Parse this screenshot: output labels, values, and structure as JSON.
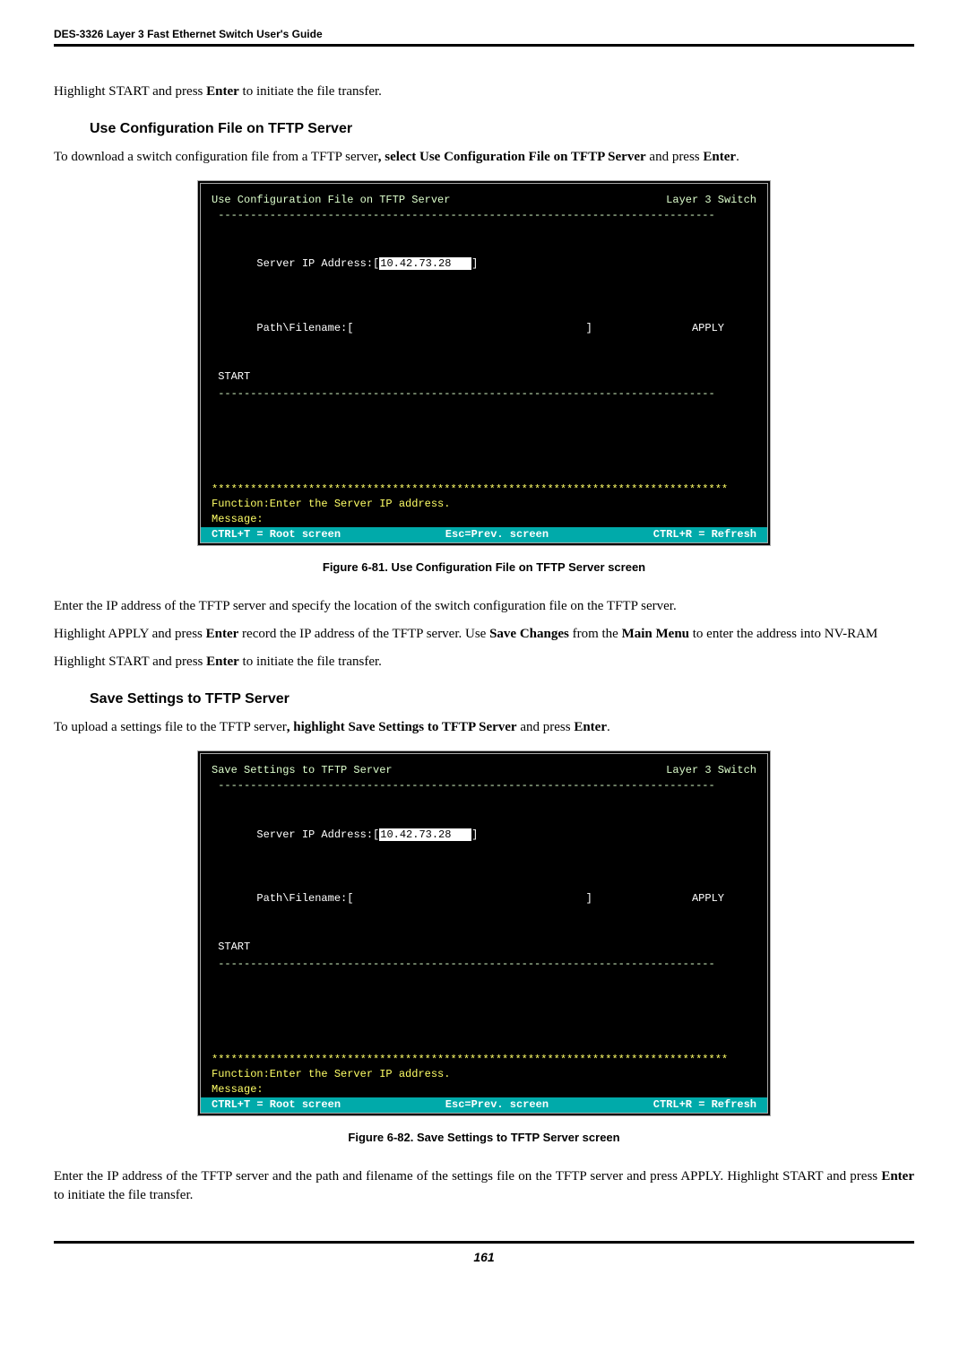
{
  "doc": {
    "headerLine": "DES-3326 Layer 3 Fast Ethernet Switch User's Guide",
    "p1_pre": "Highlight START and press ",
    "p1_b": "Enter",
    "p1_post": " to initiate the file transfer.",
    "sub1": "Use Configuration File on TFTP Server",
    "p2_pre": "To download a switch configuration file from a TFTP server",
    "p2_mid": ", select ",
    "p2_b1": "Use Configuration File on TFTP Server",
    "p2_mid2": " and press ",
    "p2_b2": "Enter",
    "p2_post": ".",
    "figcap1": "Figure 6-81.  Use Configuration File on TFTP Server screen",
    "p3": "Enter the IP address of the TFTP server and specify the location of the switch configuration file on the TFTP server.",
    "p4_pre": "Highlight APPLY and press ",
    "p4_b1": "Enter",
    "p4_mid": " record the IP address of the TFTP server. Use ",
    "p4_b2": "Save Changes",
    "p4_mid2": " from the ",
    "p4_b3": "Main Menu",
    "p4_post": " to enter the address into NV-RAM",
    "p5_pre": "Highlight START and press ",
    "p5_b": "Enter",
    "p5_post": " to initiate the file transfer.",
    "sub2": "Save Settings to TFTP Server",
    "p6_pre": "To upload a settings file to the TFTP server",
    "p6_mid": ", highlight ",
    "p6_b1": "Save Settings to TFTP Server",
    "p6_mid2": " and press ",
    "p6_b2": "Enter",
    "p6_post": ".",
    "figcap2": "Figure 6-82.  Save Settings to TFTP Server screen",
    "p7_pre": "Enter the IP address of the TFTP server and the path and filename of the settings file on the TFTP server and press APPLY. Highlight START and press ",
    "p7_b": "Enter",
    "p7_post": " to initiate the file transfer.",
    "pageNum": "161"
  },
  "term1": {
    "title": " Use Configuration File on TFTP Server",
    "layer": "Layer 3 Switch ",
    "dashline": " -----------------------------------------------------------------------------",
    "ipLabel": " Server IP Address:[",
    "ipVal": "10.42.73.28   ",
    "ipPost": "]",
    "pathLabel": " Path\\Filename:[                                    ]",
    "apply": "APPLY     ",
    "start": " START",
    "stars": "********************************************************************************",
    "func": "Function:Enter the Server IP address.",
    "msg": "Message:",
    "footerL": "CTRL+T = Root screen",
    "footerM": "Esc=Prev. screen",
    "footerR": "CTRL+R = Refresh"
  },
  "term2": {
    "title": " Save Settings to TFTP Server",
    "layer": "Layer 3 Switch ",
    "dashline": " -----------------------------------------------------------------------------",
    "ipLabel": " Server IP Address:[",
    "ipVal": "10.42.73.28   ",
    "ipPost": "]",
    "pathLabel": " Path\\Filename:[                                    ]",
    "apply": "APPLY     ",
    "start": " START",
    "stars": "********************************************************************************",
    "func": "Function:Enter the Server IP address.",
    "msg": "Message:",
    "footerL": "CTRL+T = Root screen",
    "footerM": "Esc=Prev. screen",
    "footerR": "CTRL+R = Refresh"
  }
}
